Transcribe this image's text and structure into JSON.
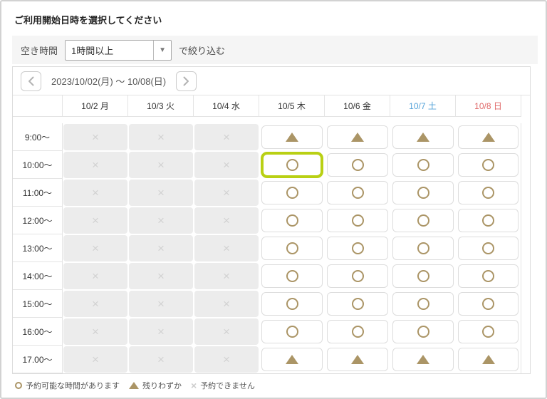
{
  "page": {
    "title": "ご利用開始日時を選択してください"
  },
  "filter": {
    "label": "空き時間",
    "selected_option": "1時間以上",
    "suffix": "で絞り込む",
    "dropdown_icon": "chevron-down-icon"
  },
  "nav": {
    "prev_icon": "chevron-left-icon",
    "range": "2023/10/02(月) ～ 10/08(日)",
    "next_icon": "chevron-right-icon"
  },
  "calendar": {
    "columns": [
      {
        "label": "10/2 月",
        "color": "#333333"
      },
      {
        "label": "10/3 火",
        "color": "#333333"
      },
      {
        "label": "10/4 水",
        "color": "#333333"
      },
      {
        "label": "10/5 木",
        "color": "#333333"
      },
      {
        "label": "10/6 金",
        "color": "#333333"
      },
      {
        "label": "10/7 土",
        "color": "#55a3d9"
      },
      {
        "label": "10/8 日",
        "color": "#e06a6a"
      }
    ],
    "rows": [
      {
        "time": "9:00～",
        "cells": [
          "x",
          "x",
          "x",
          "t",
          "t",
          "t",
          "t"
        ]
      },
      {
        "time": "10:00～",
        "cells": [
          "x",
          "x",
          "x",
          "o*",
          "o",
          "o",
          "o"
        ]
      },
      {
        "time": "11:00～",
        "cells": [
          "x",
          "x",
          "x",
          "o",
          "o",
          "o",
          "o"
        ]
      },
      {
        "time": "12:00～",
        "cells": [
          "x",
          "x",
          "x",
          "o",
          "o",
          "o",
          "o"
        ]
      },
      {
        "time": "13:00～",
        "cells": [
          "x",
          "x",
          "x",
          "o",
          "o",
          "o",
          "o"
        ]
      },
      {
        "time": "14:00～",
        "cells": [
          "x",
          "x",
          "x",
          "o",
          "o",
          "o",
          "o"
        ]
      },
      {
        "time": "15:00～",
        "cells": [
          "x",
          "x",
          "x",
          "o",
          "o",
          "o",
          "o"
        ]
      },
      {
        "time": "16:00～",
        "cells": [
          "x",
          "x",
          "x",
          "o",
          "o",
          "o",
          "o"
        ]
      },
      {
        "time": "17.00～",
        "cells": [
          "x",
          "x",
          "x",
          "t",
          "t",
          "t",
          "t"
        ]
      }
    ]
  },
  "legend": {
    "items": [
      {
        "symbol": "circle",
        "label": "予約可能な時間があります"
      },
      {
        "symbol": "triangle",
        "label": "残りわずか"
      },
      {
        "symbol": "cross",
        "label": "予約できません"
      }
    ]
  },
  "symbols": {
    "cross": "×",
    "dropdown": "▼"
  },
  "colors": {
    "available": "#ab9566",
    "highlight": "#b9d014",
    "unavailable_bg": "#ececec",
    "cross": "#d2d2d2",
    "saturday": "#55a3d9",
    "sunday": "#e06a6a"
  }
}
